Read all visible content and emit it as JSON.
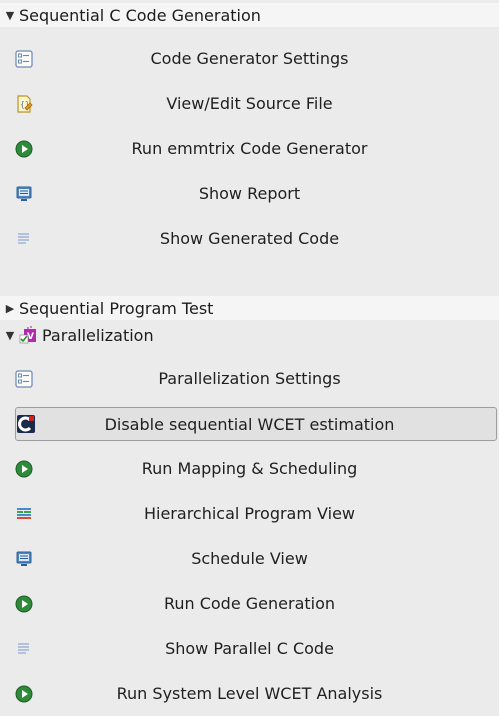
{
  "sections": {
    "seq_gen": {
      "title": "Sequential C Code Generation",
      "items": [
        {
          "label": "Code Generator Settings",
          "icon": "settings-list-icon"
        },
        {
          "label": "View/Edit Source File",
          "icon": "edit-source-file-icon"
        },
        {
          "label": "Run emmtrix Code Generator",
          "icon": "run-icon"
        },
        {
          "label": "Show Report",
          "icon": "monitor-report-icon"
        },
        {
          "label": "Show Generated Code",
          "icon": "code-lines-icon"
        }
      ]
    },
    "seq_test": {
      "title": "Sequential Program Test"
    },
    "parallel": {
      "title": "Parallelization",
      "items": [
        {
          "label": "Parallelization Settings",
          "icon": "settings-list-icon"
        },
        {
          "label": "Disable sequential WCET estimation",
          "icon": "wcet-icon"
        },
        {
          "label": "Run Mapping & Scheduling",
          "icon": "run-icon"
        },
        {
          "label": "Hierarchical Program View",
          "icon": "hierarchy-view-icon"
        },
        {
          "label": "Schedule View",
          "icon": "monitor-schedule-icon"
        },
        {
          "label": "Run Code Generation",
          "icon": "run-icon"
        },
        {
          "label": "Show Parallel C Code",
          "icon": "code-lines-icon"
        },
        {
          "label": "Run System Level WCET Analysis",
          "icon": "run-icon"
        }
      ]
    }
  },
  "colors": {
    "run_green": "#2e8b3a",
    "selected_bg": "#e1e1e1",
    "header_bg": "#f5f5f5"
  }
}
